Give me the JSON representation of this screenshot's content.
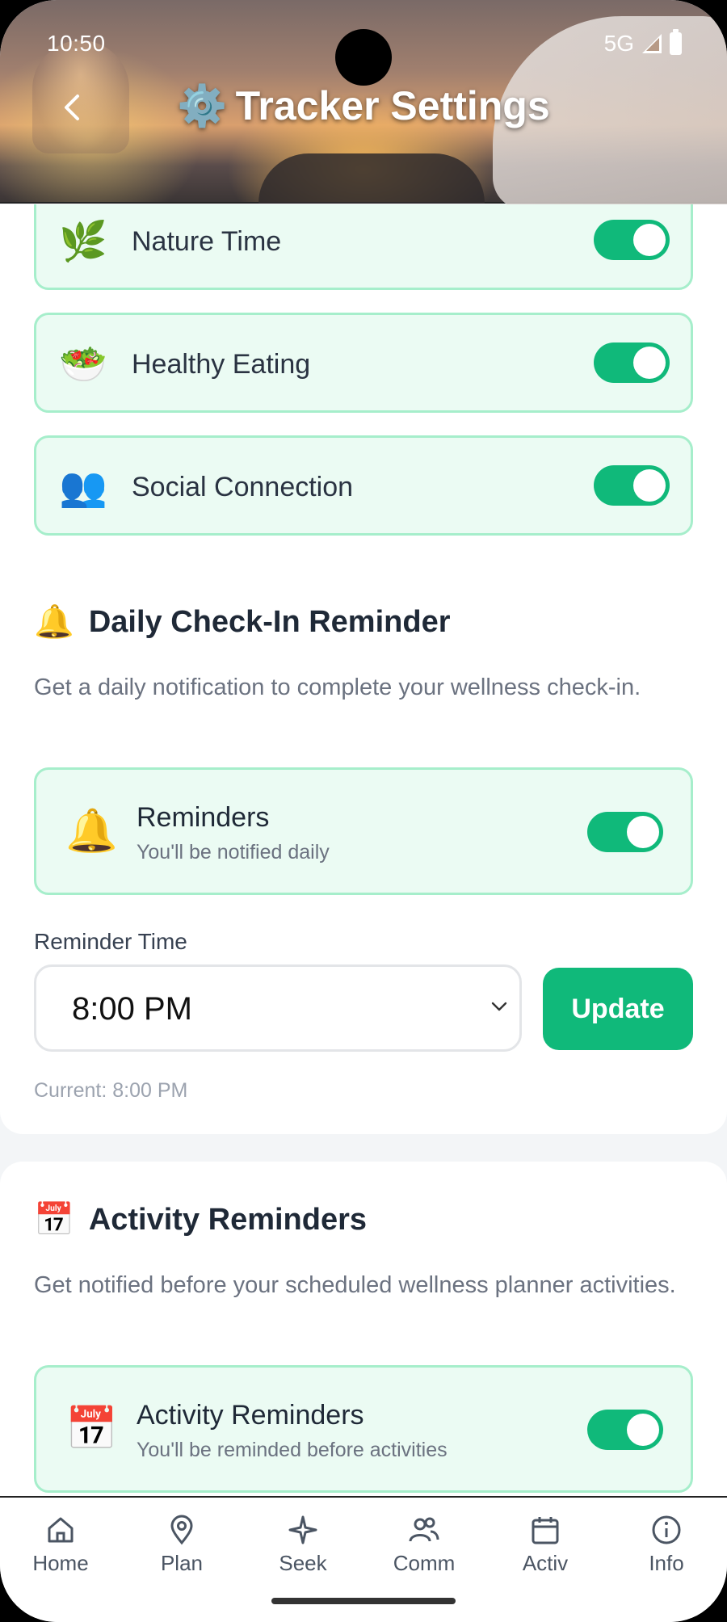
{
  "status_bar": {
    "time": "10:50",
    "network": "5G"
  },
  "header": {
    "title": "Tracker Settings",
    "icon": "⚙️",
    "back": "back-chevron"
  },
  "trackers": [
    {
      "emoji": "🌿",
      "label": "Nature Time",
      "enabled": true
    },
    {
      "emoji": "🥗",
      "label": "Healthy Eating",
      "enabled": true
    },
    {
      "emoji": "👥",
      "label": "Social Connection",
      "enabled": true
    }
  ],
  "daily_checkin": {
    "icon": "🔔",
    "title": "Daily Check-In Reminder",
    "description": "Get a daily notification to complete your wellness check-in.",
    "reminders": {
      "emoji": "🔔",
      "title": "Reminders",
      "subtitle": "You'll be notified daily",
      "enabled": true
    },
    "time_label": "Reminder Time",
    "time_value": "8:00 PM",
    "update_label": "Update",
    "current_text": "Current: 8:00 PM"
  },
  "activity_reminders": {
    "icon": "📅",
    "title": "Activity Reminders",
    "description": "Get notified before your scheduled wellness planner activities.",
    "reminders": {
      "emoji": "📅",
      "title": "Activity Reminders",
      "subtitle": "You'll be reminded before activities",
      "enabled": true
    }
  },
  "nav": [
    {
      "label": "Home",
      "icon": "home-icon"
    },
    {
      "label": "Plan",
      "icon": "map-pin-icon"
    },
    {
      "label": "Seek",
      "icon": "sparkle-icon"
    },
    {
      "label": "Comm",
      "icon": "users-icon"
    },
    {
      "label": "Activ",
      "icon": "calendar-icon"
    },
    {
      "label": "Info",
      "icon": "info-icon"
    }
  ],
  "colors": {
    "accent": "#10b97a",
    "row_bg": "#ebfbf3",
    "row_border": "#a6eecb"
  }
}
